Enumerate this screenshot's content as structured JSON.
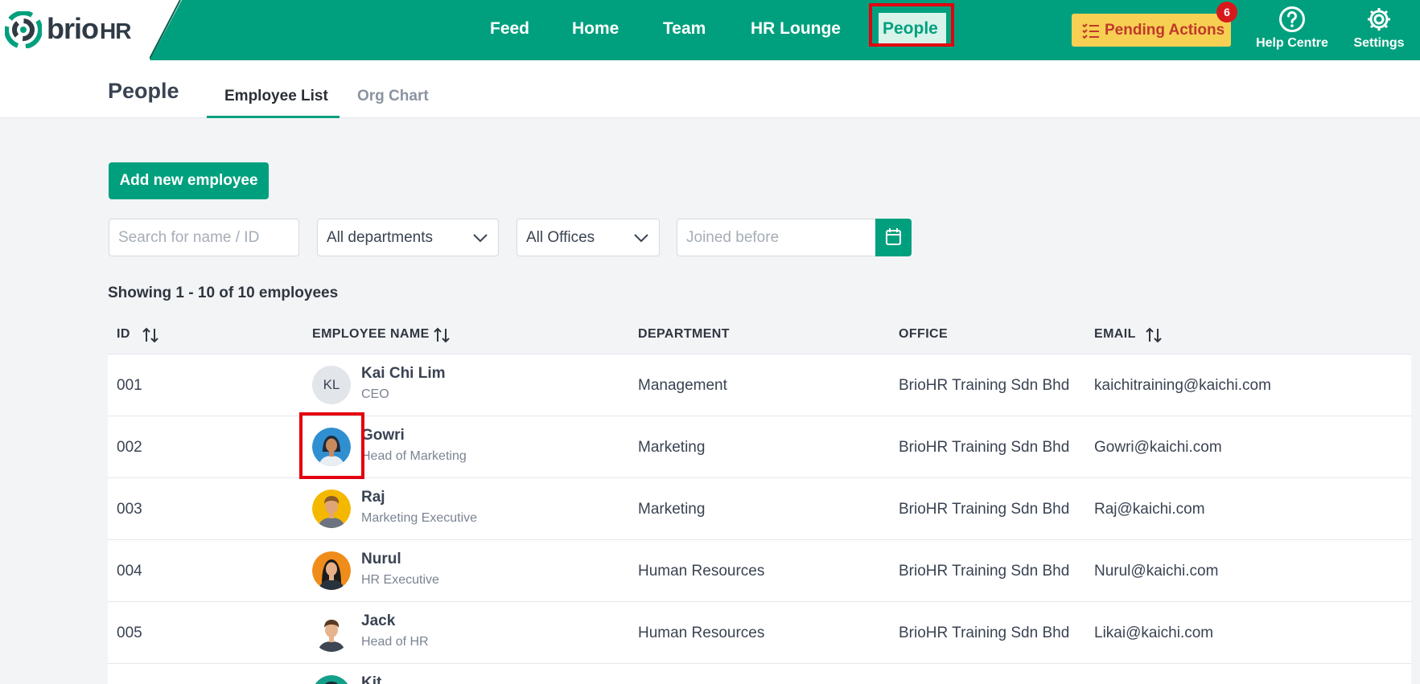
{
  "brand": {
    "name": "brio",
    "suffix": "HR",
    "accent": "#00a07e"
  },
  "nav": {
    "items": [
      {
        "label": "Feed"
      },
      {
        "label": "Home"
      },
      {
        "label": "Team"
      },
      {
        "label": "HR Lounge"
      },
      {
        "label": "People",
        "active": true
      }
    ],
    "pending_actions": {
      "label": "Pending Actions",
      "count": "6"
    },
    "help": {
      "label": "Help Centre",
      "icon": "question-circle-icon"
    },
    "settings": {
      "label": "Settings",
      "icon": "gear-icon"
    }
  },
  "header": {
    "title": "People",
    "tabs": [
      {
        "label": "Employee List",
        "active": true
      },
      {
        "label": "Org Chart",
        "active": false
      }
    ]
  },
  "controls": {
    "add_label": "Add new employee",
    "search_placeholder": "Search for name / ID",
    "department_value": "All departments",
    "office_value": "All Offices",
    "joined_placeholder": "Joined before"
  },
  "summary": "Showing 1 - 10 of 10 employees",
  "table": {
    "columns": [
      "ID",
      "EMPLOYEE NAME",
      "DEPARTMENT",
      "OFFICE",
      "EMAIL"
    ],
    "rows": [
      {
        "id": "001",
        "name": "Kai Chi Lim",
        "role": "CEO",
        "department": "Management",
        "office": "BrioHR Training Sdn Bhd",
        "email": "kaichitraining@kaichi.com",
        "avatar": "initials",
        "initials": "KL"
      },
      {
        "id": "002",
        "name": "Gowri",
        "role": "Head of Marketing",
        "department": "Marketing",
        "office": "BrioHR Training Sdn Bhd",
        "email": "Gowri@kaichi.com",
        "avatar": "woman-blue"
      },
      {
        "id": "003",
        "name": "Raj",
        "role": "Marketing Executive",
        "department": "Marketing",
        "office": "BrioHR Training Sdn Bhd",
        "email": "Raj@kaichi.com",
        "avatar": "man-yellow"
      },
      {
        "id": "004",
        "name": "Nurul",
        "role": "HR Executive",
        "department": "Human Resources",
        "office": "BrioHR Training Sdn Bhd",
        "email": "Nurul@kaichi.com",
        "avatar": "woman-orange"
      },
      {
        "id": "005",
        "name": "Jack",
        "role": "Head of HR",
        "department": "Human Resources",
        "office": "BrioHR Training Sdn Bhd",
        "email": "Likai@kaichi.com",
        "avatar": "man-white"
      },
      {
        "id": "",
        "name": "Kit",
        "role": "",
        "department": "",
        "office": "",
        "email": "",
        "avatar": "teal"
      }
    ]
  }
}
